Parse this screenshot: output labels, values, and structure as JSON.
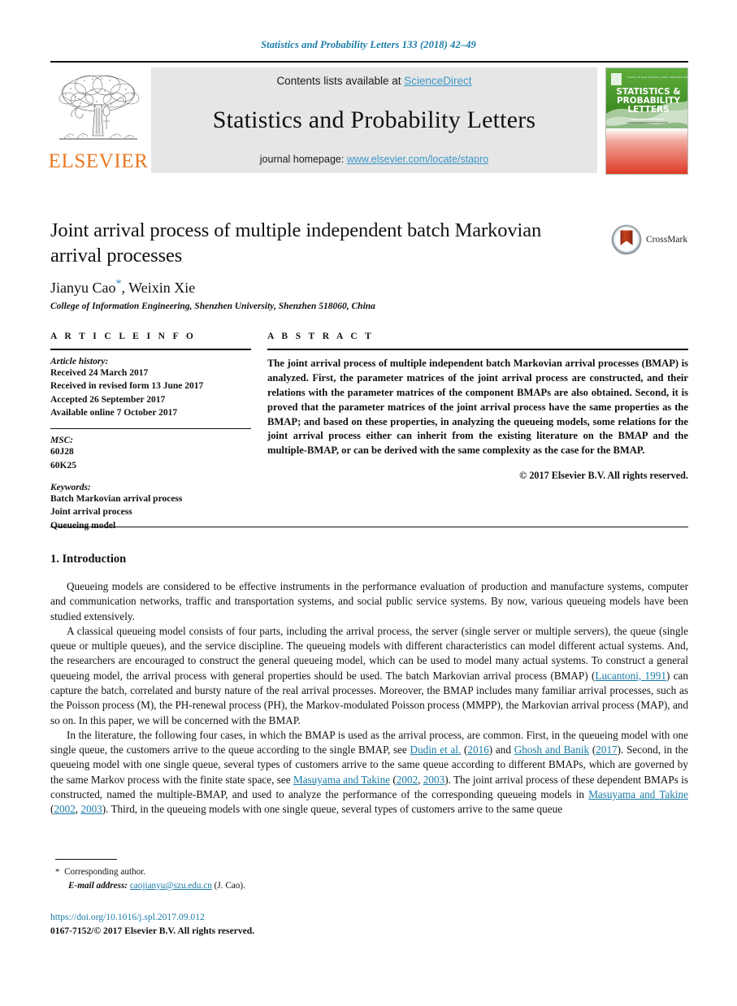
{
  "running_head": "Statistics and Probability Letters 133 (2018) 42–49",
  "masthead": {
    "contents_prefix": "Contents lists available at ",
    "contents_link": "ScienceDirect",
    "journal_title": "Statistics and Probability Letters",
    "homepage_prefix": "journal homepage: ",
    "homepage_link": "www.elsevier.com/locate/stapro",
    "publisher": "ELSEVIER",
    "cover_title_1": "STATISTICS &",
    "cover_title_2": "PROBABILITY",
    "cover_title_3": "LETTERS"
  },
  "article": {
    "title": "Joint arrival process of multiple independent batch Markovian arrival processes",
    "authors": "Jianyu Cao",
    "authors_rest": ", Weixin Xie",
    "affiliation": "College of Information Engineering, Shenzhen University, Shenzhen 518060, China",
    "crossmark_label": "CrossMark"
  },
  "info": {
    "heading": "A R T I C L E   I N F O",
    "history_label": "Article history:",
    "history": [
      "Received 24 March 2017",
      "Received in revised form 13 June 2017",
      "Accepted 26 September 2017",
      "Available online 7 October 2017"
    ],
    "msc_label": "MSC:",
    "msc": [
      "60J28",
      "60K25"
    ],
    "keywords_label": "Keywords:",
    "keywords": [
      "Batch Markovian arrival process",
      "Joint arrival process",
      "Queueing model"
    ]
  },
  "abstract": {
    "heading": "A B S T R A C T",
    "text": "The joint arrival process of multiple independent batch Markovian arrival processes (BMAP) is analyzed. First, the parameter matrices of the joint arrival process are constructed, and their relations with the parameter matrices of the component BMAPs are also obtained. Second, it is proved that the parameter matrices of the joint arrival process have the same properties as the BMAP; and based on these properties, in analyzing the queueing models, some relations for the joint arrival process either can inherit from the existing literature on the BMAP and the multiple-BMAP, or can be derived with the same complexity as the case for the BMAP.",
    "copyright": "© 2017 Elsevier B.V. All rights reserved."
  },
  "body": {
    "section_heading": "1. Introduction",
    "p1": "Queueing models are considered to be effective instruments in the performance evaluation of production and manufacture systems, computer and communication networks, traffic and transportation systems, and social public service systems. By now, various queueing models have been studied extensively.",
    "p2_a": "A classical queueing model consists of four parts, including the arrival process, the server (single server or multiple servers), the queue (single queue or multiple queues), and the service discipline. The queueing models with different characteristics can model different actual systems. And, the researchers are encouraged to construct the general queueing model, which can be used to model many actual systems. To construct a general queueing model, the arrival process with general properties should be used. The batch Markovian arrival process (BMAP)  (",
    "p2_cite1": "Lucantoni, 1991",
    "p2_b": ") can capture the batch, correlated and bursty nature of the real arrival processes. Moreover, the BMAP includes many familiar arrival processes, such as the Poisson process (M), the PH-renewal process (PH), the Markov-modulated Poisson process (MMPP), the Markovian arrival process (MAP), and so on. In this paper, we will be concerned with the BMAP.",
    "p3_a": "In the literature, the following four cases, in which the BMAP is used as the arrival process, are common. First, in the queueing model with one single queue, the customers arrive to the queue according to the single BMAP, see ",
    "p3_cite1": "Dudin et al.",
    "p3_b": " (",
    "p3_cite2": "2016",
    "p3_c": ") and ",
    "p3_cite3": "Ghosh and Banik",
    "p3_d": " (",
    "p3_cite4": "2017",
    "p3_e": "). Second, in the queueing model with one single queue, several types of customers arrive to the same queue according to different BMAPs, which are governed by the same Markov process with the finite state space, see ",
    "p3_cite5": "Masuyama and Takine",
    "p3_f": " (",
    "p3_cite6": "2002",
    "p3_g": ", ",
    "p3_cite7": "2003",
    "p3_h": "). The joint arrival process of these dependent BMAPs is constructed, named the multiple-BMAP, and used to analyze the performance of the corresponding queueing models in ",
    "p3_cite8": "Masuyama and Takine",
    "p3_i": " (",
    "p3_cite9": "2002",
    "p3_j": ", ",
    "p3_cite10": "2003",
    "p3_k": "). Third, in the queueing models with one single queue, several types of customers arrive to the same queue"
  },
  "footnotes": {
    "corresponding": "Corresponding author.",
    "email_label": "E-mail address:",
    "email": "caojianyu@szu.edu.cn",
    "email_suffix": " (J. Cao).",
    "doi": "https://doi.org/10.1016/j.spl.2017.09.012",
    "issn": "0167-7152/© 2017 Elsevier B.V. All rights reserved."
  },
  "colors": {
    "link": "#1a7ba8",
    "accent_orange": "#E87722",
    "science_direct": "#3a97c9"
  }
}
